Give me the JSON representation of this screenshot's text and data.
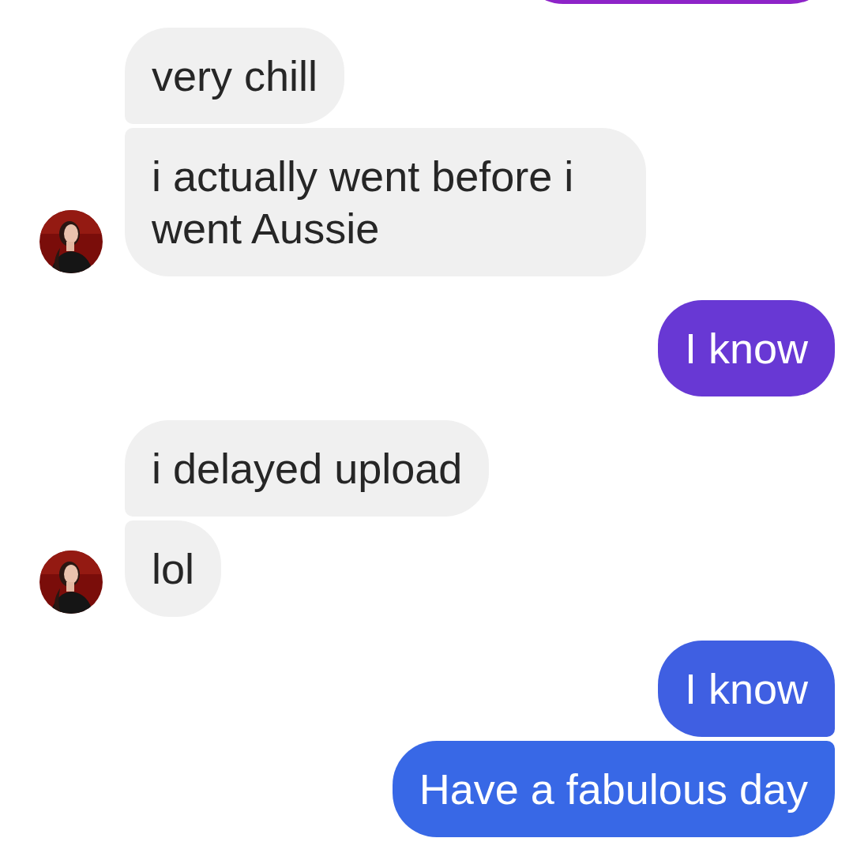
{
  "groups": [
    {
      "kind": "sent",
      "bubbles": [
        {
          "color": "#8e24c8"
        }
      ]
    },
    {
      "kind": "received",
      "bubbles": [
        {
          "text": "very chill"
        },
        {
          "text": "i actually went before i went Aussie"
        }
      ]
    },
    {
      "kind": "sent",
      "bubbles": [
        {
          "text": "I know",
          "color": "#6838d4"
        }
      ]
    },
    {
      "kind": "received",
      "bubbles": [
        {
          "text": "i delayed upload"
        },
        {
          "text": "lol"
        }
      ]
    },
    {
      "kind": "sent",
      "bubbles": [
        {
          "text": "I know",
          "color": "#3f5fe2"
        },
        {
          "text": "Have a fabulous day",
          "color": "#3868e6"
        }
      ]
    }
  ]
}
